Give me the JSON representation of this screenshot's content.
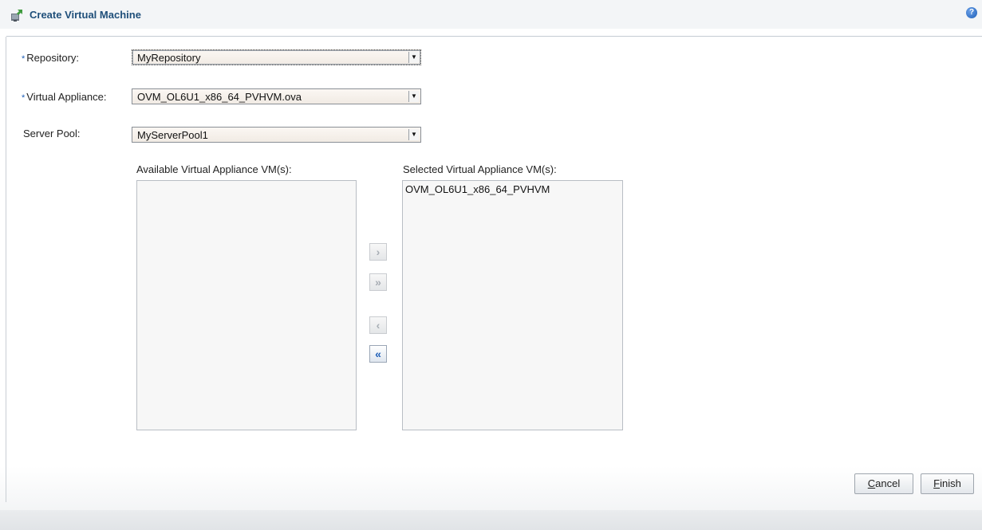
{
  "dialog": {
    "title": "Create Virtual Machine",
    "help_icon": "help-icon"
  },
  "form": {
    "required_marker": "*",
    "repository": {
      "label": "Repository:",
      "value": "MyRepository",
      "required": true
    },
    "virtual_appliance": {
      "label": "Virtual Appliance:",
      "value": "OVM_OL6U1_x86_64_PVHVM.ova",
      "required": true
    },
    "server_pool": {
      "label": "Server Pool:",
      "value": "MyServerPool1",
      "required": false
    }
  },
  "shuttle": {
    "available_label": "Available Virtual Appliance VM(s):",
    "available_items": [],
    "selected_label": "Selected Virtual Appliance VM(s):",
    "selected_items": [
      "OVM_OL6U1_x86_64_PVHVM"
    ],
    "buttons": {
      "move": "›",
      "move_all": "»",
      "remove": "‹",
      "remove_all": "«"
    }
  },
  "footer": {
    "cancel_label": "ancel",
    "cancel_mnemonic": "C",
    "finish_label": "inish",
    "finish_mnemonic": "F"
  },
  "colors": {
    "title": "#1f4f7a",
    "accent": "#1e5fb8"
  }
}
